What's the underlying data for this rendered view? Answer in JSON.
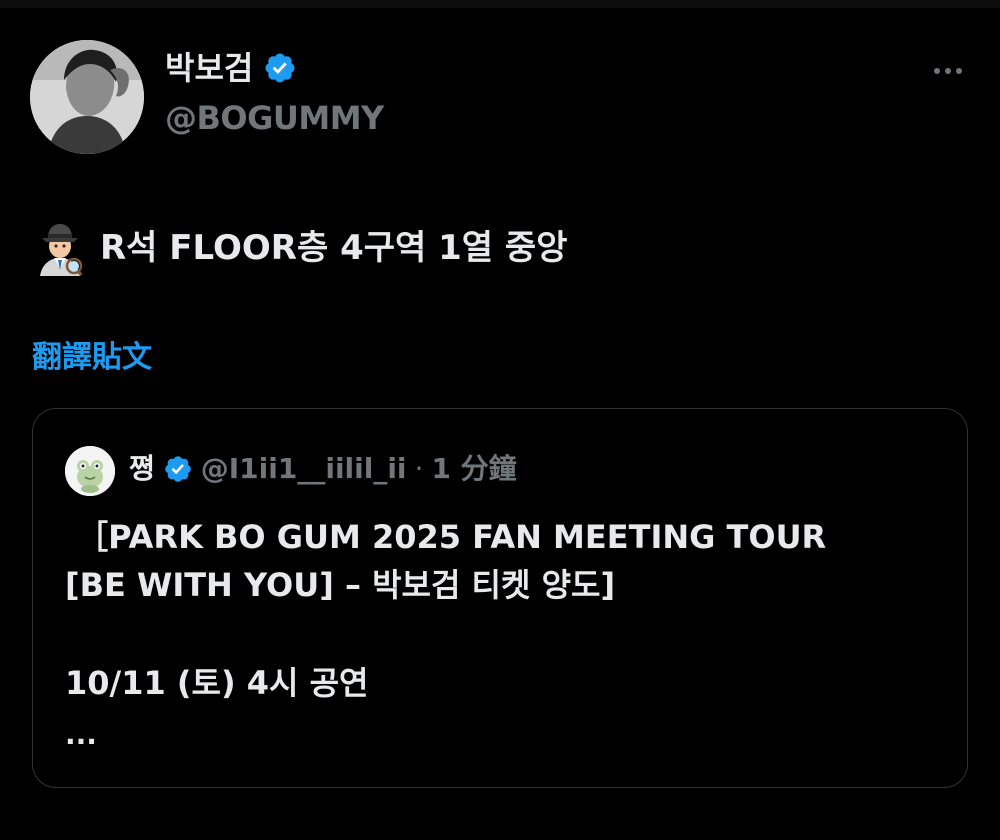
{
  "colors": {
    "background": "#000000",
    "text_primary": "#e7e9ea",
    "text_secondary": "#71767b",
    "accent_link": "#1d9bf0",
    "verified_badge": "#1d9bf0",
    "card_border": "#2f3336"
  },
  "author": {
    "avatar_icon": "profile-photo",
    "display_name": "박보검",
    "verified_icon": "verified-badge-icon",
    "handle": "@BOGUMMY"
  },
  "menu": {
    "more_icon": "more-horizontal-icon"
  },
  "tweet": {
    "emoji": "detective-emoji",
    "text": "R석 FLOOR층 4구역 1열 중앙",
    "translate_label": "翻譯貼文"
  },
  "quoted_tweet": {
    "avatar_icon": "frog-avatar",
    "name": "쪙",
    "verified_icon": "verified-badge-icon",
    "handle": "@I1ii1__iilil_ii",
    "separator": "·",
    "time": "1 分鐘",
    "line1": " ［PARK BO GUM 2025 FAN MEETING TOUR",
    "line2": "[BE WITH YOU] – 박보검 티켓 양도]",
    "line3": "10/11 (토) 4시 공연",
    "ellipsis": "..."
  }
}
